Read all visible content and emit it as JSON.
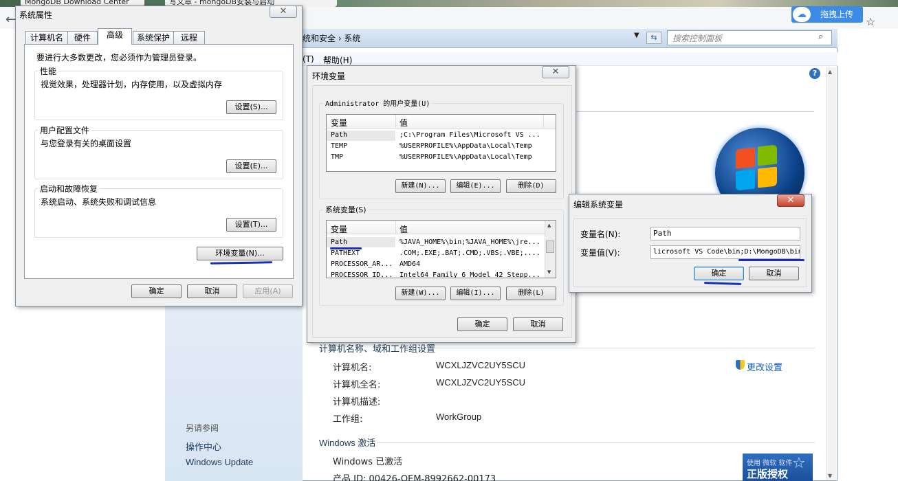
{
  "browser": {
    "tabs": [
      "MongoDB Download Center",
      "写文章 - mongoDB安装与启动"
    ],
    "baidu_upload_label": "拖拽上传"
  },
  "control_panel": {
    "breadcrumb": "统和安全  ›  系统",
    "search_placeholder": "搜索控制面板",
    "menu_t": "(T)",
    "menu_help": "帮助(H)",
    "sidebar": {
      "see_also": "另请参阅",
      "action_center": "操作中心",
      "windows_update": "Windows Update"
    },
    "computer_section": {
      "title": "计算机名称、域和工作组设置",
      "change_settings": "更改设置",
      "rows": [
        {
          "label": "计算机名:",
          "value": "WCXLJZVC2UY5SCU"
        },
        {
          "label": "计算机全名:",
          "value": "WCXLJZVC2UY5SCU"
        },
        {
          "label": "计算机描述:",
          "value": ""
        },
        {
          "label": "工作组:",
          "value": "WorkGroup"
        }
      ]
    },
    "activation_section": {
      "title": "Windows 激活",
      "status": "Windows 已激活",
      "product_id": "产品 ID: 00426-OEM-8992662-00173"
    },
    "genuine": {
      "small": "使用 微软 软件",
      "big": "正版授权"
    }
  },
  "sys_props": {
    "title": "系统属性",
    "close": "✕",
    "tabs": [
      "计算机名",
      "硬件",
      "高级",
      "系统保护",
      "远程"
    ],
    "note": "要进行大多数更改，您必须作为管理员登录。",
    "groups": [
      {
        "title": "性能",
        "desc": "视觉效果，处理器计划，内存使用，以及虚拟内存",
        "button": "设置(S)..."
      },
      {
        "title": "用户配置文件",
        "desc": "与您登录有关的桌面设置",
        "button": "设置(E)..."
      },
      {
        "title": "启动和故障恢复",
        "desc": "系统启动、系统失败和调试信息",
        "button": "设置(T)..."
      }
    ],
    "env_button": "环境变量(N)...",
    "ok": "确定",
    "cancel": "取消",
    "apply": "应用(A)"
  },
  "env_vars": {
    "title": "环境变量",
    "close": "✕",
    "user_group_title": "Administrator 的用户变量(U)",
    "col_var": "变量",
    "col_val": "值",
    "user_rows": [
      {
        "name": "Path",
        "value": ";C:\\Program Files\\Microsoft VS ..."
      },
      {
        "name": "TEMP",
        "value": "%USERPROFILE%\\AppData\\Local\\Temp"
      },
      {
        "name": "TMP",
        "value": "%USERPROFILE%\\AppData\\Local\\Temp"
      }
    ],
    "user_buttons": [
      "新建(N)...",
      "编辑(E)...",
      "删除(D)"
    ],
    "sys_group_title": "系统变量(S)",
    "sys_rows": [
      {
        "name": "Path",
        "value": "%JAVA_HOME%\\bin;%JAVA_HOME%\\jre..."
      },
      {
        "name": "PATHEXT",
        "value": ".COM;.EXE;.BAT;.CMD;.VBS;.VBE;...."
      },
      {
        "name": "PROCESSOR_AR...",
        "value": "AMD64"
      },
      {
        "name": "PROCESSOR_ID...",
        "value": "Intel64 Family 6 Model 42 Stepp..."
      }
    ],
    "sys_buttons": [
      "新建(W)...",
      "编辑(I)...",
      "删除(L)"
    ],
    "ok": "确定",
    "cancel": "取消"
  },
  "edit_var": {
    "title": "编辑系统变量",
    "close": "✕",
    "name_label": "变量名(N):",
    "name_value": "Path",
    "value_label": "变量值(V):",
    "value_value": "licrosoft VS Code\\bin;D:\\MongoDB\\bin",
    "ok": "确定",
    "cancel": "取消"
  }
}
